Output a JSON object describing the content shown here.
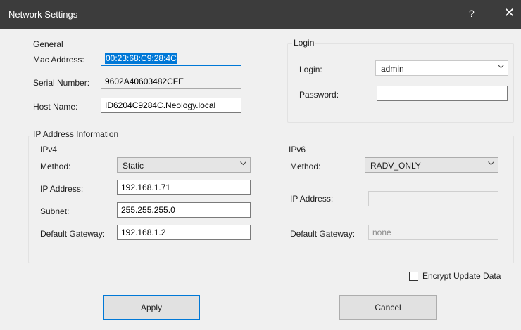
{
  "window": {
    "title": "Network Settings",
    "help_glyph": "?",
    "close_glyph": "✕"
  },
  "general": {
    "legend": "General",
    "mac_label": "Mac Address:",
    "mac_value": "00:23:68:C9:28:4C",
    "serial_label": "Serial Number:",
    "serial_value": "9602A40603482CFE",
    "host_label": "Host Name:",
    "host_value": "ID6204C9284C.Neology.local"
  },
  "login": {
    "legend": "Login",
    "login_label": "Login:",
    "login_value": "admin",
    "password_label": "Password:",
    "password_value": ""
  },
  "ip_info": {
    "legend": "IP Address Information",
    "ipv4": {
      "legend": "IPv4",
      "method_label": "Method:",
      "method_value": "Static",
      "ip_label": "IP Address:",
      "ip_value": "192.168.1.71",
      "subnet_label": "Subnet:",
      "subnet_value": "255.255.255.0",
      "gateway_label": "Default Gateway:",
      "gateway_value": "192.168.1.2"
    },
    "ipv6": {
      "legend": "IPv6",
      "method_label": "Method:",
      "method_value": "RADV_ONLY",
      "ip_label": "IP Address:",
      "ip_value": "",
      "gateway_label": "Default Gateway:",
      "gateway_value": "none"
    }
  },
  "encrypt": {
    "label": "Encrypt Update Data",
    "checked": false
  },
  "buttons": {
    "apply": "Apply",
    "cancel": "Cancel"
  }
}
